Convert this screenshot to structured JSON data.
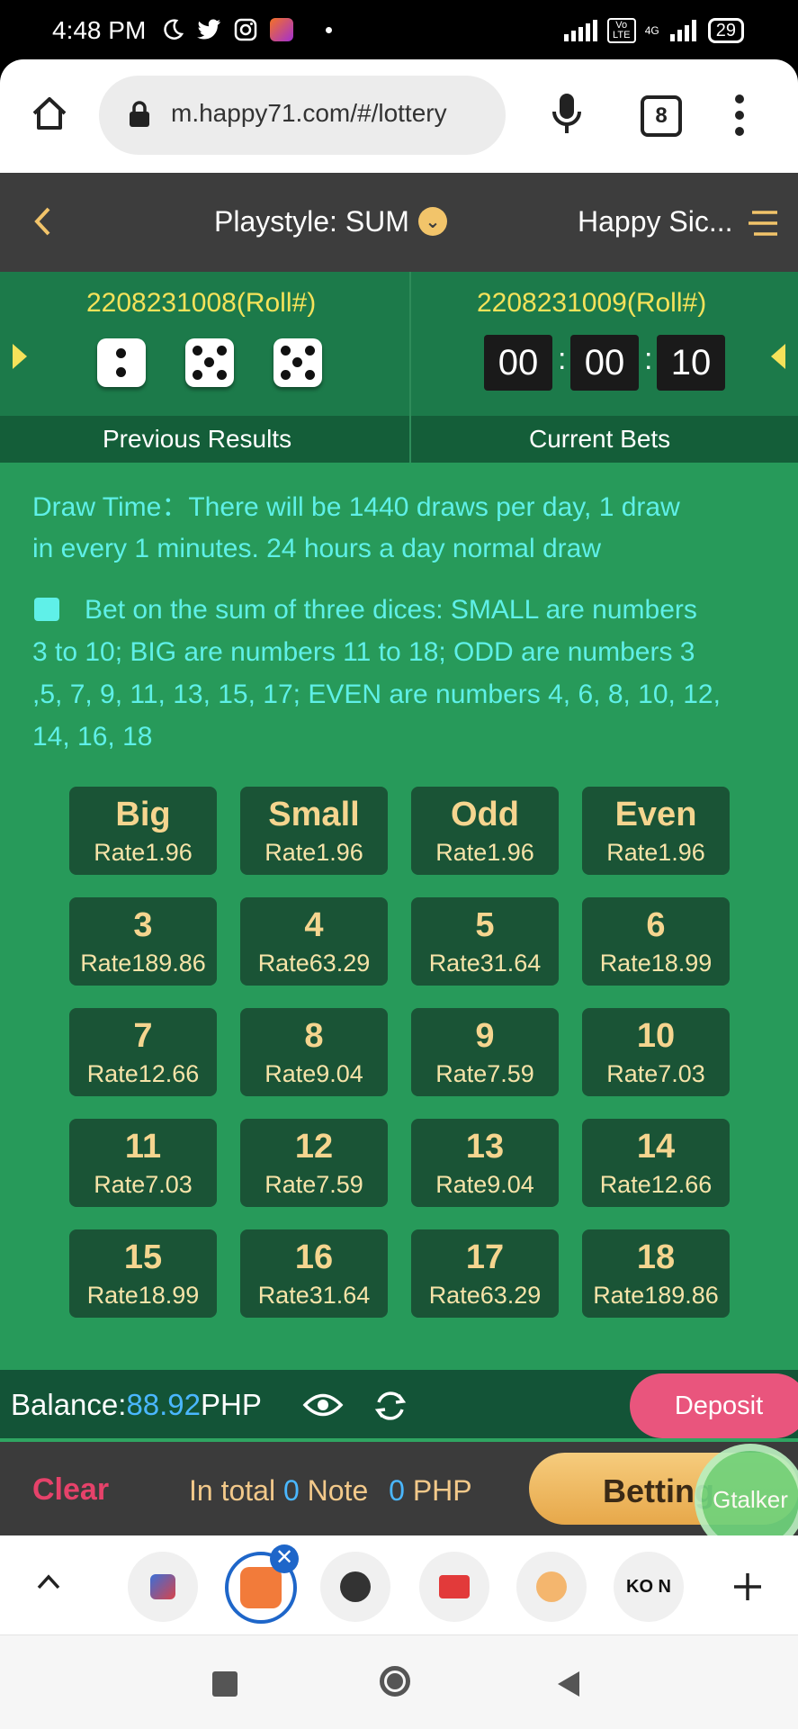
{
  "status_bar": {
    "time": "4:48 PM",
    "battery": "29",
    "icons": [
      "moon-icon",
      "twitter-icon",
      "instagram-icon",
      "lazada-icon",
      "signal-icon",
      "volte-icon",
      "4g-icon"
    ],
    "network_labels": {
      "volte": "Vo LTE",
      "fourg": "4G"
    }
  },
  "browser": {
    "url": "m.happy71.com/#/lottery",
    "tab_count": "8"
  },
  "header": {
    "playstyle": "Playstyle: SUM",
    "game_title": "Happy Sic..."
  },
  "rounds": {
    "previous_roll": "2208231008(Roll#)",
    "previous_dice": [
      2,
      5,
      5
    ],
    "current_roll": "2208231009(Roll#)",
    "countdown": {
      "hours": "00",
      "minutes": "00",
      "seconds": "10",
      "sep": ":"
    }
  },
  "tabs": {
    "previous": "Previous Results",
    "current": "Current Bets"
  },
  "info": {
    "line1": "Draw Time：There will be 1440 draws per day, 1 draw",
    "line2": "in every 1 minutes. 24 hours a day normal draw",
    "rule_line1": "Bet on the sum of three dices: SMALL are numbers",
    "rule_line2": "3 to 10; BIG are numbers 11 to 18; ODD are numbers 3",
    "rule_line3": ",5, 7, 9, 11, 13, 15, 17; EVEN are numbers 4, 6, 8, 10, 12,",
    "rule_line4": "14, 16, 18"
  },
  "bets": [
    {
      "label": "Big",
      "rate": "Rate1.96"
    },
    {
      "label": "Small",
      "rate": "Rate1.96"
    },
    {
      "label": "Odd",
      "rate": "Rate1.96"
    },
    {
      "label": "Even",
      "rate": "Rate1.96"
    },
    {
      "label": "3",
      "rate": "Rate189.86"
    },
    {
      "label": "4",
      "rate": "Rate63.29"
    },
    {
      "label": "5",
      "rate": "Rate31.64"
    },
    {
      "label": "6",
      "rate": "Rate18.99"
    },
    {
      "label": "7",
      "rate": "Rate12.66"
    },
    {
      "label": "8",
      "rate": "Rate9.04"
    },
    {
      "label": "9",
      "rate": "Rate7.59"
    },
    {
      "label": "10",
      "rate": "Rate7.03"
    },
    {
      "label": "11",
      "rate": "Rate7.03"
    },
    {
      "label": "12",
      "rate": "Rate7.59"
    },
    {
      "label": "13",
      "rate": "Rate9.04"
    },
    {
      "label": "14",
      "rate": "Rate12.66"
    },
    {
      "label": "15",
      "rate": "Rate18.99"
    },
    {
      "label": "16",
      "rate": "Rate31.64"
    },
    {
      "label": "17",
      "rate": "Rate63.29"
    },
    {
      "label": "18",
      "rate": "Rate189.86"
    }
  ],
  "balance": {
    "label": "Balance:",
    "value": "88.92",
    "currency": "PHP",
    "deposit": "Deposit"
  },
  "betbar": {
    "clear": "Clear",
    "in_total": "In total",
    "notes": "0",
    "note_label": "Note",
    "amount": "0",
    "currency": "PHP",
    "betting": "Betting",
    "gtalker": "Gtalker"
  },
  "shelf": {
    "icons": [
      "chevron-up-icon",
      "shield-app-icon",
      "happy71-app-icon",
      "anime-app-icon",
      "video-app-icon",
      "avatar-app-icon",
      "koin-app-icon",
      "plus-icon"
    ],
    "koin_label": "KO N"
  },
  "colors": {
    "app_green": "#279a5a",
    "header_gray": "#3d3d3d",
    "gold": "#f5d58f",
    "accent_pink": "#e9557d",
    "balance_blue": "#4ab7ff"
  }
}
